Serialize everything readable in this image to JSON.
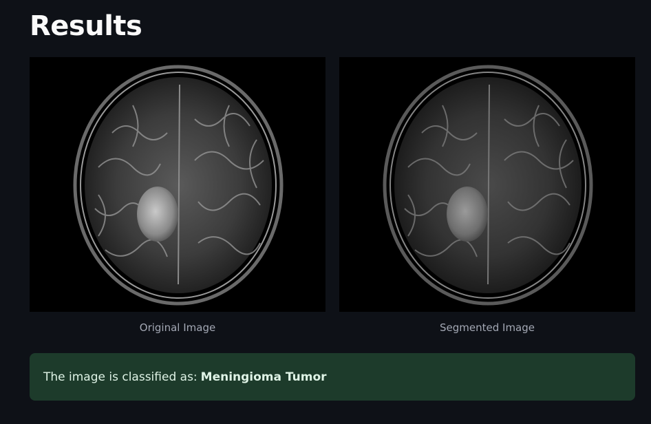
{
  "page": {
    "title": "Results"
  },
  "images": {
    "original": {
      "caption": "Original Image",
      "description": "axial-brain-mri-with-tumor"
    },
    "segmented": {
      "caption": "Segmented Image",
      "description": "axial-brain-mri-segmented"
    }
  },
  "result": {
    "prefix": "The image is classified as:",
    "classification": "Meningioma Tumor"
  },
  "colors": {
    "background": "#0e1117",
    "alert_background": "#1d3b2b",
    "alert_text": "#dff3e6"
  }
}
